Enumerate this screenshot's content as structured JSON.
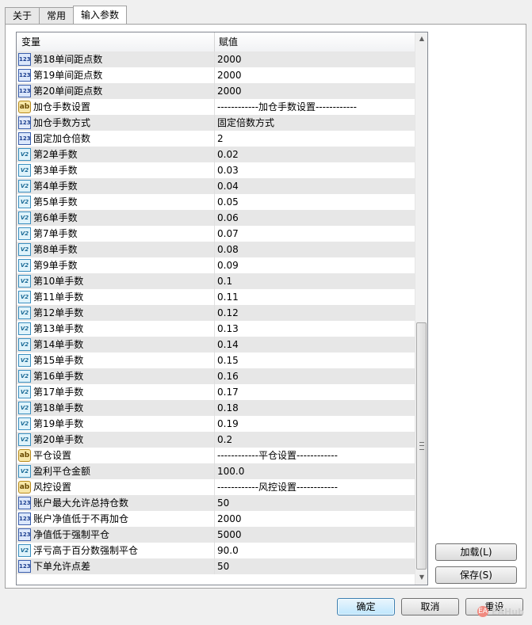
{
  "tabs": [
    {
      "label": "关于",
      "active": false
    },
    {
      "label": "常用",
      "active": false
    },
    {
      "label": "输入参数",
      "active": true
    }
  ],
  "grid": {
    "columns": {
      "variable": "变量",
      "value": "赋值"
    },
    "rows": [
      {
        "type": "int",
        "name": "第18单间距点数",
        "value": "2000"
      },
      {
        "type": "int",
        "name": "第19单间距点数",
        "value": "2000"
      },
      {
        "type": "int",
        "name": "第20单间距点数",
        "value": "2000"
      },
      {
        "type": "str",
        "name": "加仓手数设置",
        "value": "------------加仓手数设置------------"
      },
      {
        "type": "enum",
        "name": "加仓手数方式",
        "value": "固定倍数方式"
      },
      {
        "type": "int",
        "name": "固定加仓倍数",
        "value": "2"
      },
      {
        "type": "dbl",
        "name": "第2单手数",
        "value": "0.02"
      },
      {
        "type": "dbl",
        "name": "第3单手数",
        "value": "0.03"
      },
      {
        "type": "dbl",
        "name": "第4单手数",
        "value": "0.04"
      },
      {
        "type": "dbl",
        "name": "第5单手数",
        "value": "0.05"
      },
      {
        "type": "dbl",
        "name": "第6单手数",
        "value": "0.06"
      },
      {
        "type": "dbl",
        "name": "第7单手数",
        "value": "0.07"
      },
      {
        "type": "dbl",
        "name": "第8单手数",
        "value": "0.08"
      },
      {
        "type": "dbl",
        "name": "第9单手数",
        "value": "0.09"
      },
      {
        "type": "dbl",
        "name": "第10单手数",
        "value": "0.1"
      },
      {
        "type": "dbl",
        "name": "第11单手数",
        "value": "0.11"
      },
      {
        "type": "dbl",
        "name": "第12单手数",
        "value": "0.12"
      },
      {
        "type": "dbl",
        "name": "第13单手数",
        "value": "0.13"
      },
      {
        "type": "dbl",
        "name": "第14单手数",
        "value": "0.14"
      },
      {
        "type": "dbl",
        "name": "第15单手数",
        "value": "0.15"
      },
      {
        "type": "dbl",
        "name": "第16单手数",
        "value": "0.16"
      },
      {
        "type": "dbl",
        "name": "第17单手数",
        "value": "0.17"
      },
      {
        "type": "dbl",
        "name": "第18单手数",
        "value": "0.18"
      },
      {
        "type": "dbl",
        "name": "第19单手数",
        "value": "0.19"
      },
      {
        "type": "dbl",
        "name": "第20单手数",
        "value": "0.2"
      },
      {
        "type": "str",
        "name": "平仓设置",
        "value": "------------平仓设置------------"
      },
      {
        "type": "dbl",
        "name": "盈利平仓金额",
        "value": "100.0"
      },
      {
        "type": "str",
        "name": "风控设置",
        "value": "------------风控设置------------"
      },
      {
        "type": "int",
        "name": "账户最大允许总持仓数",
        "value": "50"
      },
      {
        "type": "int",
        "name": "账户净值低于不再加仓",
        "value": "2000"
      },
      {
        "type": "int",
        "name": "净值低于强制平仓",
        "value": "5000"
      },
      {
        "type": "dbl",
        "name": "浮亏高于百分数强制平仓",
        "value": "90.0"
      },
      {
        "type": "int",
        "name": "下单允许点差",
        "value": "50"
      }
    ]
  },
  "icons": {
    "int": "123",
    "dbl": "V2",
    "str": "ab",
    "enum": "123"
  },
  "buttons": {
    "load": "加载(L)",
    "save": "保存(S)",
    "ok": "确定",
    "cancel": "取消",
    "reset": "重设"
  },
  "watermark": {
    "text": "EAHub",
    "icon": "EA"
  }
}
